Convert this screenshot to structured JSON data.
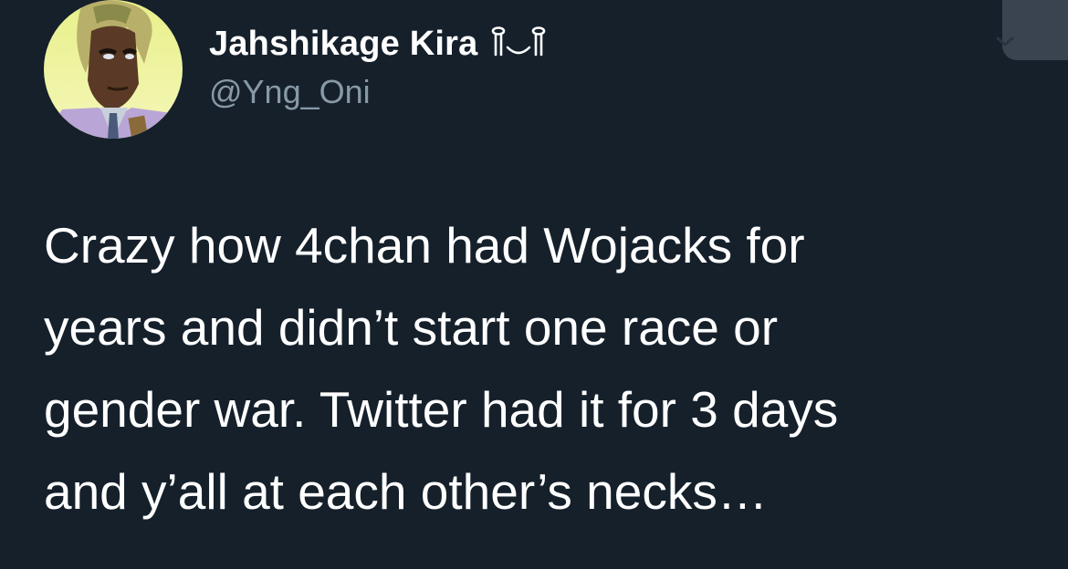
{
  "tweet": {
    "author": {
      "display_name": "Jahshikage Kira",
      "name_suffix_icon": "kaomoji-emoji",
      "handle": "@Yng_Oni",
      "avatar_icon": "anime-character-avatar"
    },
    "text_lines": [
      "Crazy how 4chan had Wojacks for",
      "years and didn’t start one race or",
      "gender war. Twitter had it for 3 days",
      "and y’all at each other’s necks…"
    ]
  },
  "colors": {
    "background": "#15202b",
    "text": "#ffffff",
    "secondary_text": "#8899a6"
  }
}
